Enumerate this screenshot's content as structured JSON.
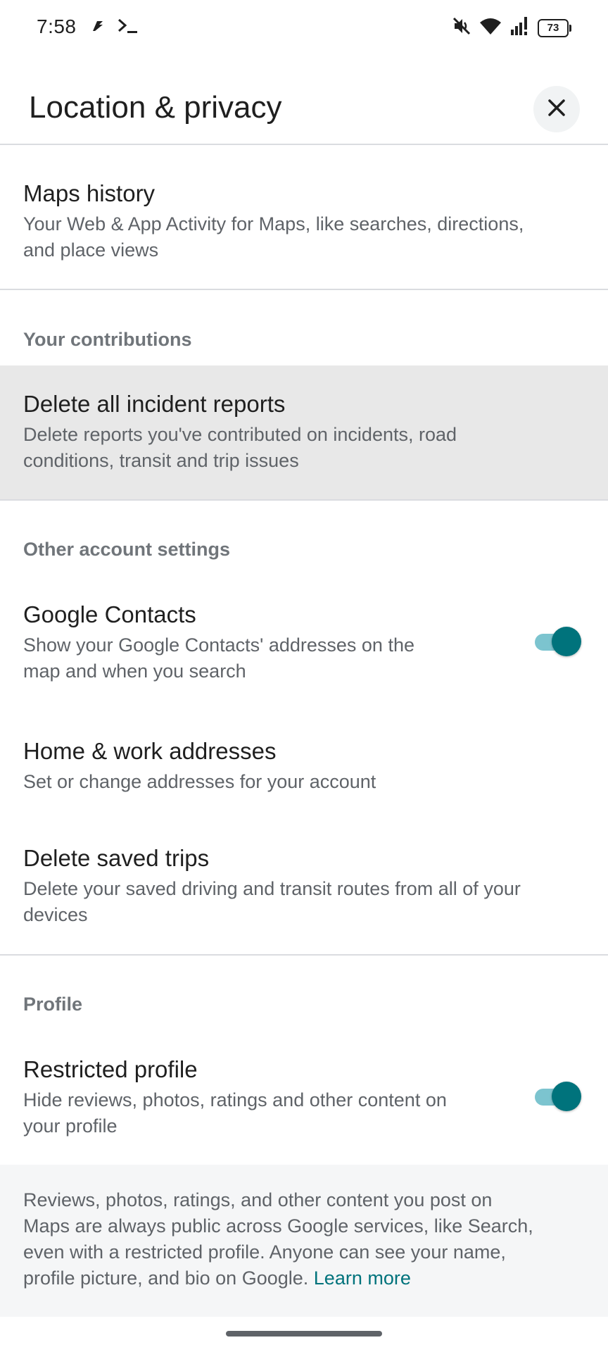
{
  "status_bar": {
    "time": "7:58",
    "battery": "73",
    "icons": [
      "app-notification-icon",
      "terminal-icon",
      "mute-icon",
      "wifi-icon",
      "signal-icon"
    ]
  },
  "header": {
    "title": "Location & privacy",
    "close_icon": "close-icon"
  },
  "maps_history": {
    "title": "Maps history",
    "subtitle_line1": "Your Web & App Activity for Maps, like searches, directions,",
    "subtitle_line2": "and place views"
  },
  "contributions": {
    "section_label": "Your contributions",
    "delete_reports": {
      "title": "Delete all incident reports",
      "subtitle_line1": "Delete reports you've contributed on incidents, road",
      "subtitle_line2": "conditions, transit and trip issues"
    }
  },
  "other_settings": {
    "section_label": "Other account settings",
    "google_contacts": {
      "title": "Google Contacts",
      "subtitle_line1": "Show your Google Contacts' addresses on the",
      "subtitle_line2": "map and when you search",
      "enabled": true
    },
    "home_work": {
      "title": "Home & work addresses",
      "subtitle": "Set or change addresses for your account"
    },
    "saved_trips": {
      "title": "Delete saved trips",
      "subtitle_line1": "Delete your saved driving and transit routes from all of your",
      "subtitle_line2": "devices"
    }
  },
  "profile": {
    "section_label": "Profile",
    "restricted": {
      "title": "Restricted profile",
      "subtitle_line1": "Hide reviews, photos, ratings and other content on",
      "subtitle_line2": "your profile",
      "enabled": true
    }
  },
  "info": {
    "line1": "Reviews, photos, ratings, and other content you post on",
    "line2": "Maps are always public across Google services, like Search,",
    "line3": "even with a restricted profile. Anyone can see your name,",
    "line4": "profile picture, and bio on Google.",
    "link": "Learn more"
  },
  "colors": {
    "accent": "#00737c",
    "toggle_track": "#7cc4cf",
    "highlight": "#e8e8e8"
  }
}
